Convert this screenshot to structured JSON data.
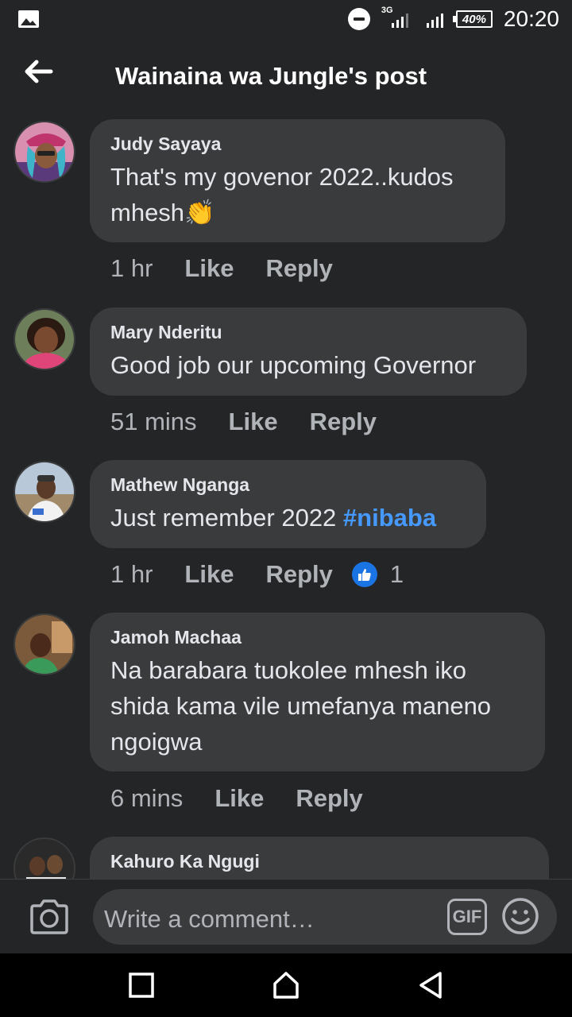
{
  "status_bar": {
    "network_type": "3G",
    "battery": "40%",
    "time": "20:20"
  },
  "header": {
    "title": "Wainaina wa Jungle's post"
  },
  "comments": [
    {
      "author": "Judy Sayaya",
      "text": "That's my govenor 2022..kudos mhesh",
      "emoji": "👏",
      "time": "1 hr",
      "like_label": "Like",
      "reply_label": "Reply"
    },
    {
      "author": "Mary Nderitu",
      "text": "Good job our upcoming Governor",
      "time": "51 mins",
      "like_label": "Like",
      "reply_label": "Reply"
    },
    {
      "author": "Mathew Nganga",
      "text": "Just remember 2022 ",
      "hashtag": "#nibaba",
      "time": "1 hr",
      "like_label": "Like",
      "reply_label": "Reply",
      "reaction_count": "1"
    },
    {
      "author": "Jamoh Machaa",
      "text": "Na barabara tuokolee mhesh iko shida kama vile umefanya maneno ngoigwa",
      "time": "6 mins",
      "like_label": "Like",
      "reply_label": "Reply"
    },
    {
      "author": "Kahuro Ka Ngugi"
    }
  ],
  "composer": {
    "placeholder": "Write a comment…",
    "gif_label": "GIF"
  },
  "colors": {
    "background": "#242526",
    "bubble": "#3a3b3c",
    "hashtag": "#4599ff",
    "like_blue": "#1b74e4"
  }
}
